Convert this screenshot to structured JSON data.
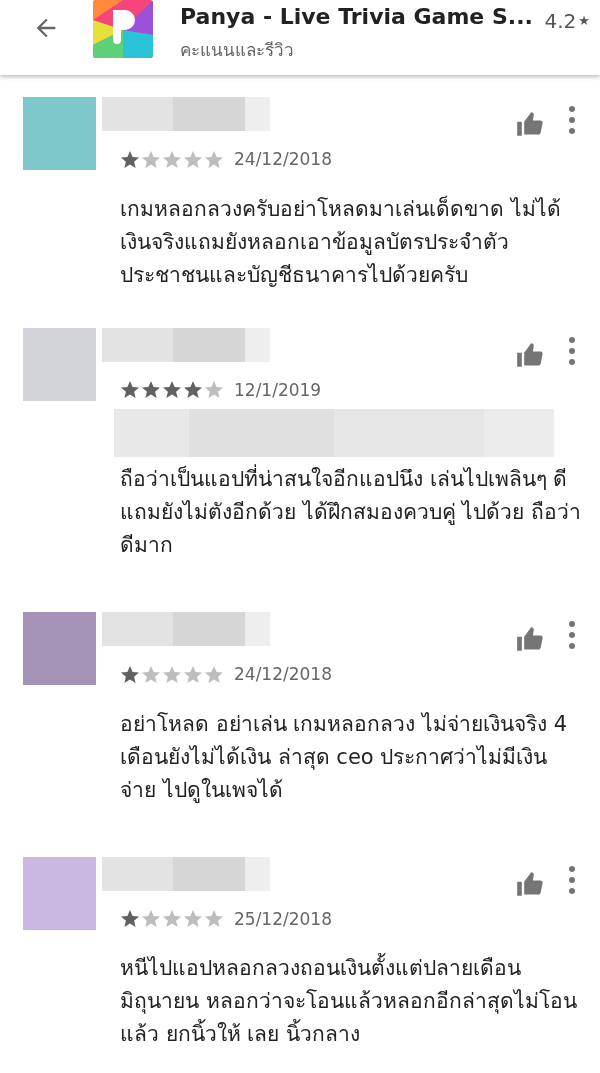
{
  "header": {
    "title": "Panya - Live Trivia Game S...",
    "rating": "4.2",
    "rating_star": "★",
    "subtitle": "คะแนนและรีวิว"
  },
  "reviews": [
    {
      "color": "#7ec8cc",
      "stars": 1,
      "date": "24/12/2018",
      "title_redacted": false,
      "text": "เกมหลอกลวงครับอย่าโหลดมาเล่นเด็ดขาด ไม่ได้เงินจริงแถมยังหลอกเอาข้อมูลบัตรประจำตัวประชาชนและบัญชีธนาคารไปด้วยครับ"
    },
    {
      "color": "#d3d3da",
      "stars": 4,
      "date": "12/1/2019",
      "title_redacted": true,
      "text": "ถือว่าเป็นแอปที่น่าสนใจอีกแอปนึง เล่นไปเพลินๆ ดี แถมยังไม่ตังอีกด้วย ได้ฝึกสมองควบคู่ ไปด้วย ถือว่าดีมาก"
    },
    {
      "color": "#a594b8",
      "stars": 1,
      "date": "24/12/2018",
      "title_redacted": false,
      "text": "อย่าโหลด อย่าเล่น เกมหลอกลวง ไม่จ่ายเงินจริง 4 เดือนยังไม่ได้เงิน ล่าสุด ceo ประกาศว่าไม่มีเงินจ่าย ไปดูในเพจได้"
    },
    {
      "color": "#c9b9e2",
      "stars": 1,
      "date": "25/12/2018",
      "title_redacted": false,
      "text": "หนีไปแอปหลอกลวงถอนเงินตั้งแต่ปลายเดือน มิถุนายน หลอกว่าจะโอนแล้วหลอกอีกล่าสุดไม่โอนแล้ว ยกนิ้วให้ เลย นิ้วกลาง"
    }
  ]
}
